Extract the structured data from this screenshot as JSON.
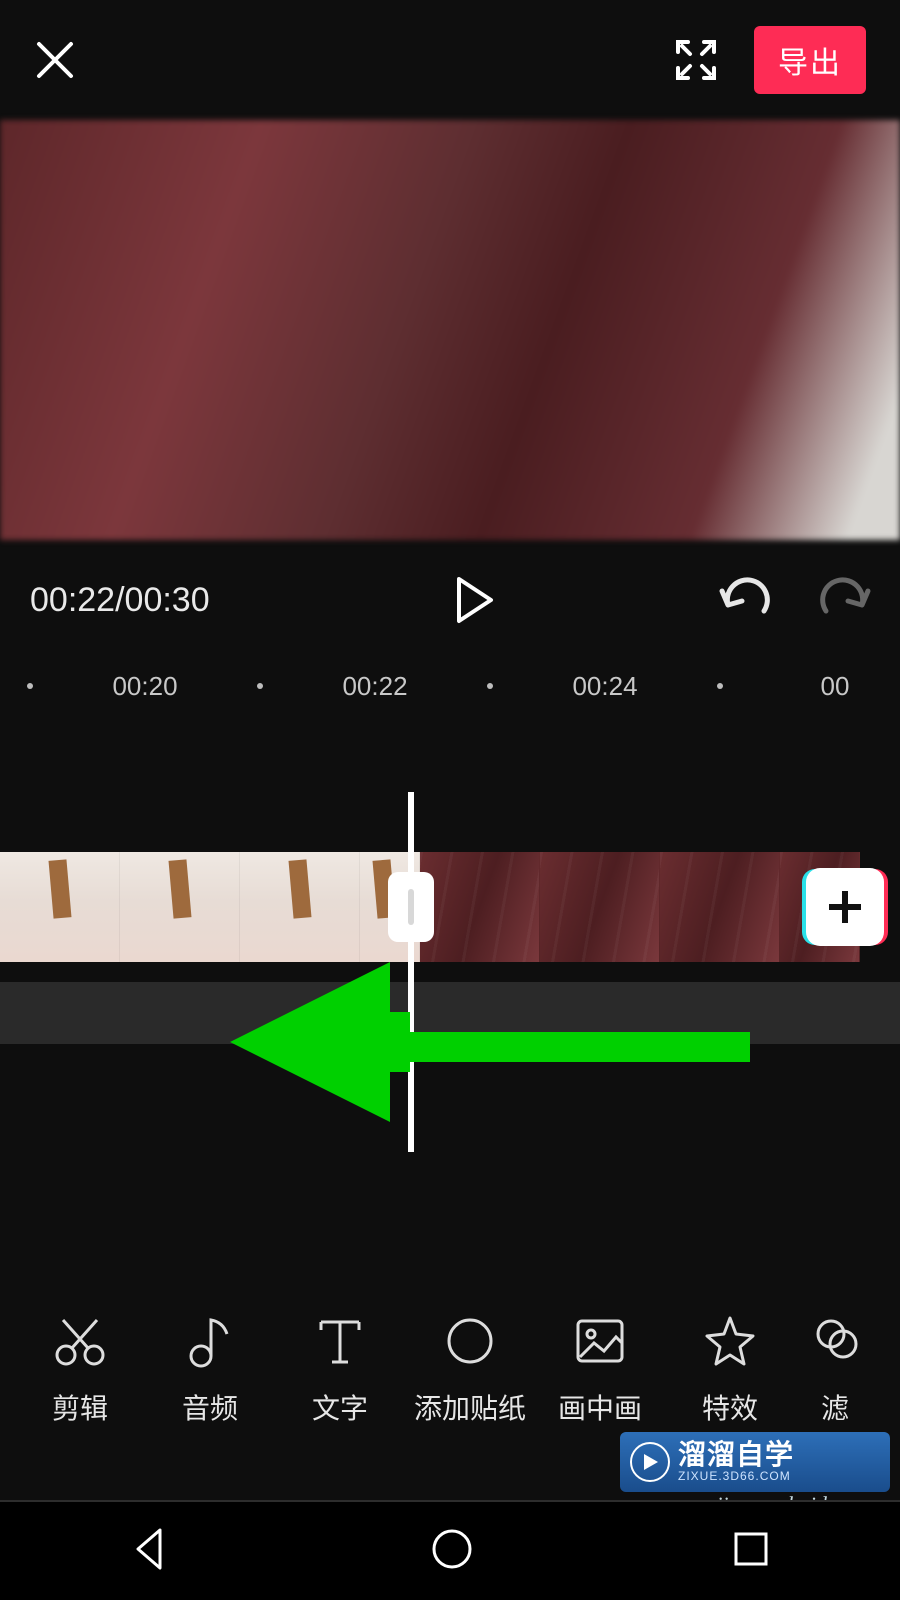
{
  "header": {
    "export_label": "导出"
  },
  "playback": {
    "time_display": "00:22/00:30"
  },
  "ruler": {
    "marks": [
      "00:20",
      "00:22",
      "00:24",
      "00"
    ]
  },
  "toolbar": {
    "items": [
      {
        "name": "cut",
        "label": "剪辑",
        "icon": "scissors-icon"
      },
      {
        "name": "audio",
        "label": "音频",
        "icon": "music-note-icon"
      },
      {
        "name": "text",
        "label": "文字",
        "icon": "text-t-icon"
      },
      {
        "name": "sticker",
        "label": "添加贴纸",
        "icon": "moon-icon"
      },
      {
        "name": "pip",
        "label": "画中画",
        "icon": "picture-icon"
      },
      {
        "name": "effects",
        "label": "特效",
        "icon": "star-icon"
      },
      {
        "name": "filter",
        "label": "滤",
        "icon": "filter-icon"
      }
    ]
  },
  "watermark": {
    "brand": "溜溜自学",
    "site": "ZIXUE.3D66.COM",
    "credit": "jingyan.baidu.com"
  },
  "annotation": {
    "direction": "left",
    "color": "#00d000"
  }
}
